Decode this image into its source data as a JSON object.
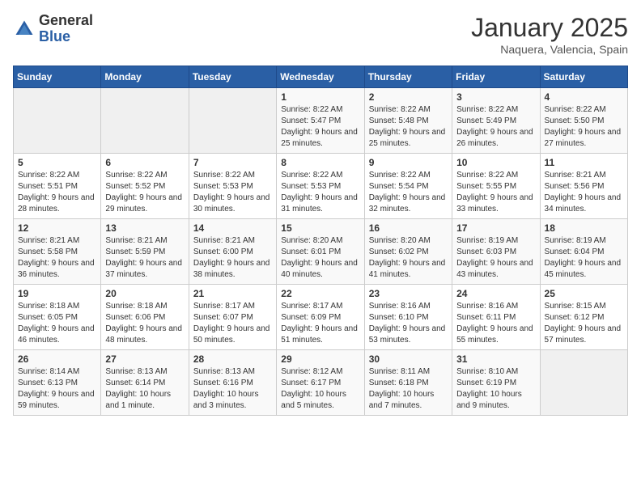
{
  "header": {
    "logo_general": "General",
    "logo_blue": "Blue",
    "month": "January 2025",
    "location": "Naquera, Valencia, Spain"
  },
  "days_of_week": [
    "Sunday",
    "Monday",
    "Tuesday",
    "Wednesday",
    "Thursday",
    "Friday",
    "Saturday"
  ],
  "weeks": [
    [
      {
        "day": "",
        "sunrise": "",
        "sunset": "",
        "daylight": ""
      },
      {
        "day": "",
        "sunrise": "",
        "sunset": "",
        "daylight": ""
      },
      {
        "day": "",
        "sunrise": "",
        "sunset": "",
        "daylight": ""
      },
      {
        "day": "1",
        "sunrise": "Sunrise: 8:22 AM",
        "sunset": "Sunset: 5:47 PM",
        "daylight": "Daylight: 9 hours and 25 minutes."
      },
      {
        "day": "2",
        "sunrise": "Sunrise: 8:22 AM",
        "sunset": "Sunset: 5:48 PM",
        "daylight": "Daylight: 9 hours and 25 minutes."
      },
      {
        "day": "3",
        "sunrise": "Sunrise: 8:22 AM",
        "sunset": "Sunset: 5:49 PM",
        "daylight": "Daylight: 9 hours and 26 minutes."
      },
      {
        "day": "4",
        "sunrise": "Sunrise: 8:22 AM",
        "sunset": "Sunset: 5:50 PM",
        "daylight": "Daylight: 9 hours and 27 minutes."
      }
    ],
    [
      {
        "day": "5",
        "sunrise": "Sunrise: 8:22 AM",
        "sunset": "Sunset: 5:51 PM",
        "daylight": "Daylight: 9 hours and 28 minutes."
      },
      {
        "day": "6",
        "sunrise": "Sunrise: 8:22 AM",
        "sunset": "Sunset: 5:52 PM",
        "daylight": "Daylight: 9 hours and 29 minutes."
      },
      {
        "day": "7",
        "sunrise": "Sunrise: 8:22 AM",
        "sunset": "Sunset: 5:53 PM",
        "daylight": "Daylight: 9 hours and 30 minutes."
      },
      {
        "day": "8",
        "sunrise": "Sunrise: 8:22 AM",
        "sunset": "Sunset: 5:53 PM",
        "daylight": "Daylight: 9 hours and 31 minutes."
      },
      {
        "day": "9",
        "sunrise": "Sunrise: 8:22 AM",
        "sunset": "Sunset: 5:54 PM",
        "daylight": "Daylight: 9 hours and 32 minutes."
      },
      {
        "day": "10",
        "sunrise": "Sunrise: 8:22 AM",
        "sunset": "Sunset: 5:55 PM",
        "daylight": "Daylight: 9 hours and 33 minutes."
      },
      {
        "day": "11",
        "sunrise": "Sunrise: 8:21 AM",
        "sunset": "Sunset: 5:56 PM",
        "daylight": "Daylight: 9 hours and 34 minutes."
      }
    ],
    [
      {
        "day": "12",
        "sunrise": "Sunrise: 8:21 AM",
        "sunset": "Sunset: 5:58 PM",
        "daylight": "Daylight: 9 hours and 36 minutes."
      },
      {
        "day": "13",
        "sunrise": "Sunrise: 8:21 AM",
        "sunset": "Sunset: 5:59 PM",
        "daylight": "Daylight: 9 hours and 37 minutes."
      },
      {
        "day": "14",
        "sunrise": "Sunrise: 8:21 AM",
        "sunset": "Sunset: 6:00 PM",
        "daylight": "Daylight: 9 hours and 38 minutes."
      },
      {
        "day": "15",
        "sunrise": "Sunrise: 8:20 AM",
        "sunset": "Sunset: 6:01 PM",
        "daylight": "Daylight: 9 hours and 40 minutes."
      },
      {
        "day": "16",
        "sunrise": "Sunrise: 8:20 AM",
        "sunset": "Sunset: 6:02 PM",
        "daylight": "Daylight: 9 hours and 41 minutes."
      },
      {
        "day": "17",
        "sunrise": "Sunrise: 8:19 AM",
        "sunset": "Sunset: 6:03 PM",
        "daylight": "Daylight: 9 hours and 43 minutes."
      },
      {
        "day": "18",
        "sunrise": "Sunrise: 8:19 AM",
        "sunset": "Sunset: 6:04 PM",
        "daylight": "Daylight: 9 hours and 45 minutes."
      }
    ],
    [
      {
        "day": "19",
        "sunrise": "Sunrise: 8:18 AM",
        "sunset": "Sunset: 6:05 PM",
        "daylight": "Daylight: 9 hours and 46 minutes."
      },
      {
        "day": "20",
        "sunrise": "Sunrise: 8:18 AM",
        "sunset": "Sunset: 6:06 PM",
        "daylight": "Daylight: 9 hours and 48 minutes."
      },
      {
        "day": "21",
        "sunrise": "Sunrise: 8:17 AM",
        "sunset": "Sunset: 6:07 PM",
        "daylight": "Daylight: 9 hours and 50 minutes."
      },
      {
        "day": "22",
        "sunrise": "Sunrise: 8:17 AM",
        "sunset": "Sunset: 6:09 PM",
        "daylight": "Daylight: 9 hours and 51 minutes."
      },
      {
        "day": "23",
        "sunrise": "Sunrise: 8:16 AM",
        "sunset": "Sunset: 6:10 PM",
        "daylight": "Daylight: 9 hours and 53 minutes."
      },
      {
        "day": "24",
        "sunrise": "Sunrise: 8:16 AM",
        "sunset": "Sunset: 6:11 PM",
        "daylight": "Daylight: 9 hours and 55 minutes."
      },
      {
        "day": "25",
        "sunrise": "Sunrise: 8:15 AM",
        "sunset": "Sunset: 6:12 PM",
        "daylight": "Daylight: 9 hours and 57 minutes."
      }
    ],
    [
      {
        "day": "26",
        "sunrise": "Sunrise: 8:14 AM",
        "sunset": "Sunset: 6:13 PM",
        "daylight": "Daylight: 9 hours and 59 minutes."
      },
      {
        "day": "27",
        "sunrise": "Sunrise: 8:13 AM",
        "sunset": "Sunset: 6:14 PM",
        "daylight": "Daylight: 10 hours and 1 minute."
      },
      {
        "day": "28",
        "sunrise": "Sunrise: 8:13 AM",
        "sunset": "Sunset: 6:16 PM",
        "daylight": "Daylight: 10 hours and 3 minutes."
      },
      {
        "day": "29",
        "sunrise": "Sunrise: 8:12 AM",
        "sunset": "Sunset: 6:17 PM",
        "daylight": "Daylight: 10 hours and 5 minutes."
      },
      {
        "day": "30",
        "sunrise": "Sunrise: 8:11 AM",
        "sunset": "Sunset: 6:18 PM",
        "daylight": "Daylight: 10 hours and 7 minutes."
      },
      {
        "day": "31",
        "sunrise": "Sunrise: 8:10 AM",
        "sunset": "Sunset: 6:19 PM",
        "daylight": "Daylight: 10 hours and 9 minutes."
      },
      {
        "day": "",
        "sunrise": "",
        "sunset": "",
        "daylight": ""
      }
    ]
  ]
}
